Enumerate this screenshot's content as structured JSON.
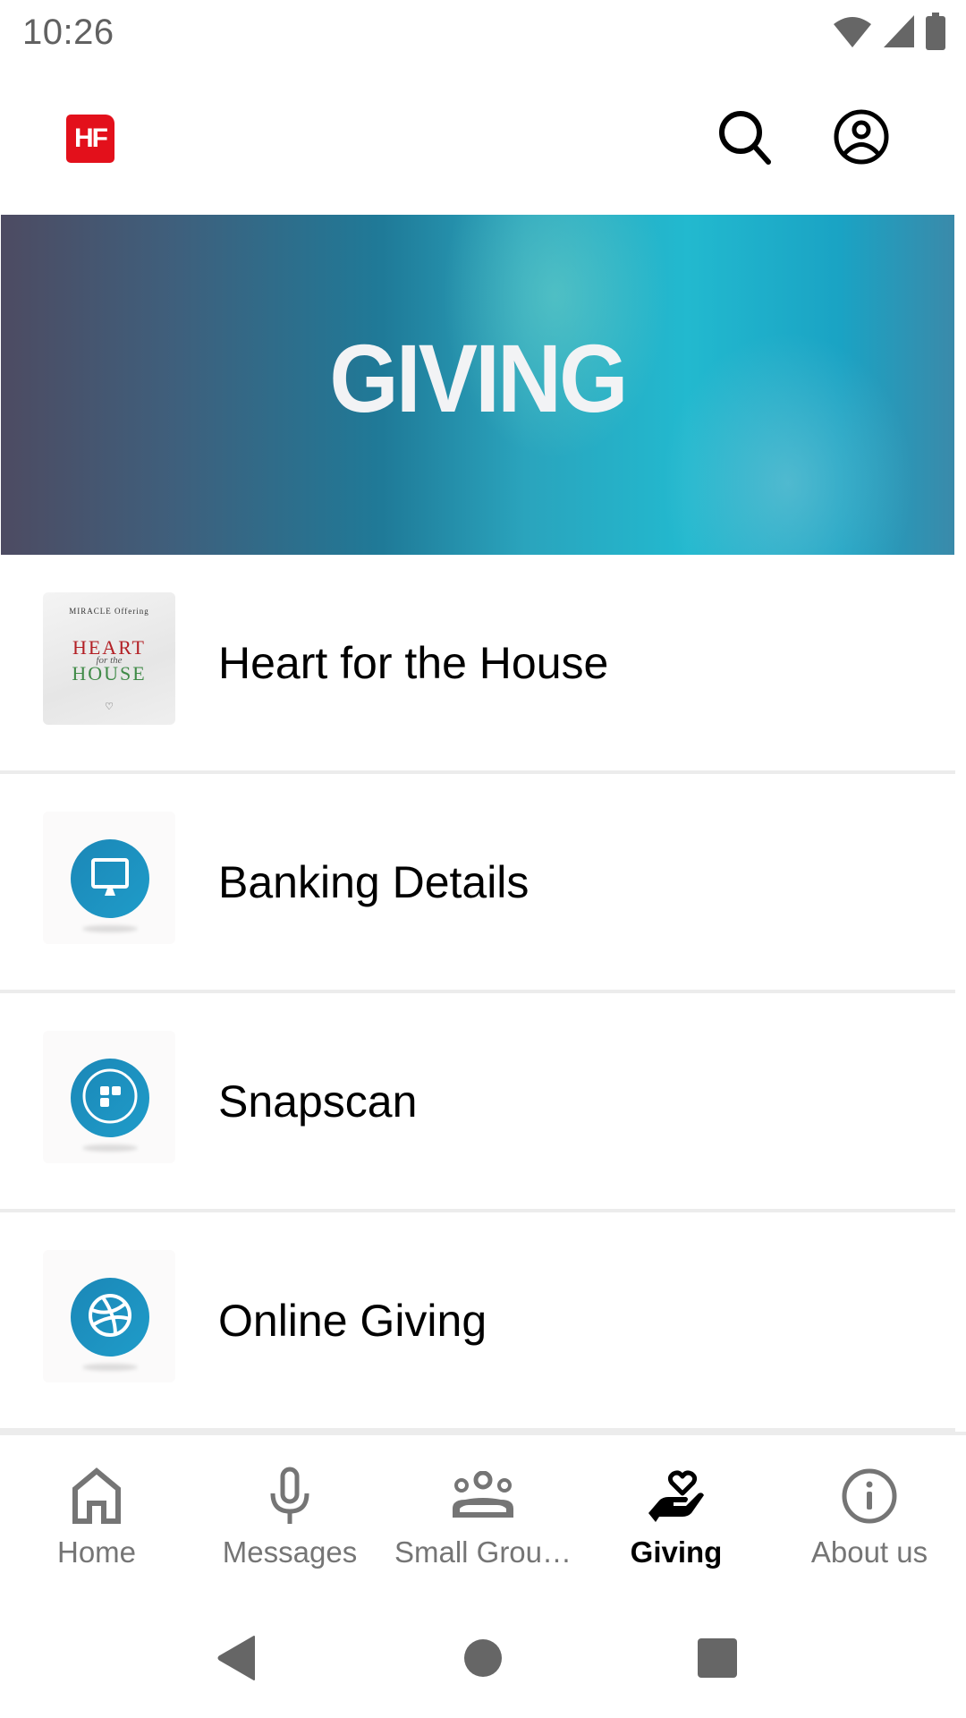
{
  "status_bar": {
    "time": "10:26",
    "icons": [
      "wifi-icon",
      "cell-signal-icon",
      "battery-icon"
    ]
  },
  "app_bar": {
    "logo_text": "HF",
    "brand_color": "#e3101b",
    "actions": [
      {
        "name": "search",
        "icon": "search-icon"
      },
      {
        "name": "profile",
        "icon": "account-circle-icon"
      }
    ]
  },
  "banner": {
    "title": "GIVING"
  },
  "list": {
    "items": [
      {
        "label": "Heart for the House",
        "thumbnail": "poster",
        "poster": {
          "top": "MIRACLE Offering",
          "heart": "HEART",
          "for": "for the",
          "house": "HOUSE",
          "mark": "♡"
        }
      },
      {
        "label": "Banking Details",
        "thumbnail": "monitor-icon",
        "icon_color": "#1b8fc0"
      },
      {
        "label": "Snapscan",
        "thumbnail": "snapscan-icon",
        "icon_color": "#1b8fc0"
      },
      {
        "label": "Online Giving",
        "thumbnail": "dribbble-ball-icon",
        "icon_color": "#1b8fc0"
      }
    ]
  },
  "bottom_nav": {
    "items": [
      {
        "label": "Home",
        "icon": "home-icon",
        "active": false
      },
      {
        "label": "Messages",
        "icon": "microphone-icon",
        "active": false
      },
      {
        "label": "Small Grou…",
        "icon": "groups-icon",
        "active": false
      },
      {
        "label": "Giving",
        "icon": "hand-heart-icon",
        "active": true
      },
      {
        "label": "About us",
        "icon": "info-icon",
        "active": false
      }
    ]
  },
  "system_nav": {
    "buttons": [
      "back",
      "home",
      "recents"
    ]
  }
}
